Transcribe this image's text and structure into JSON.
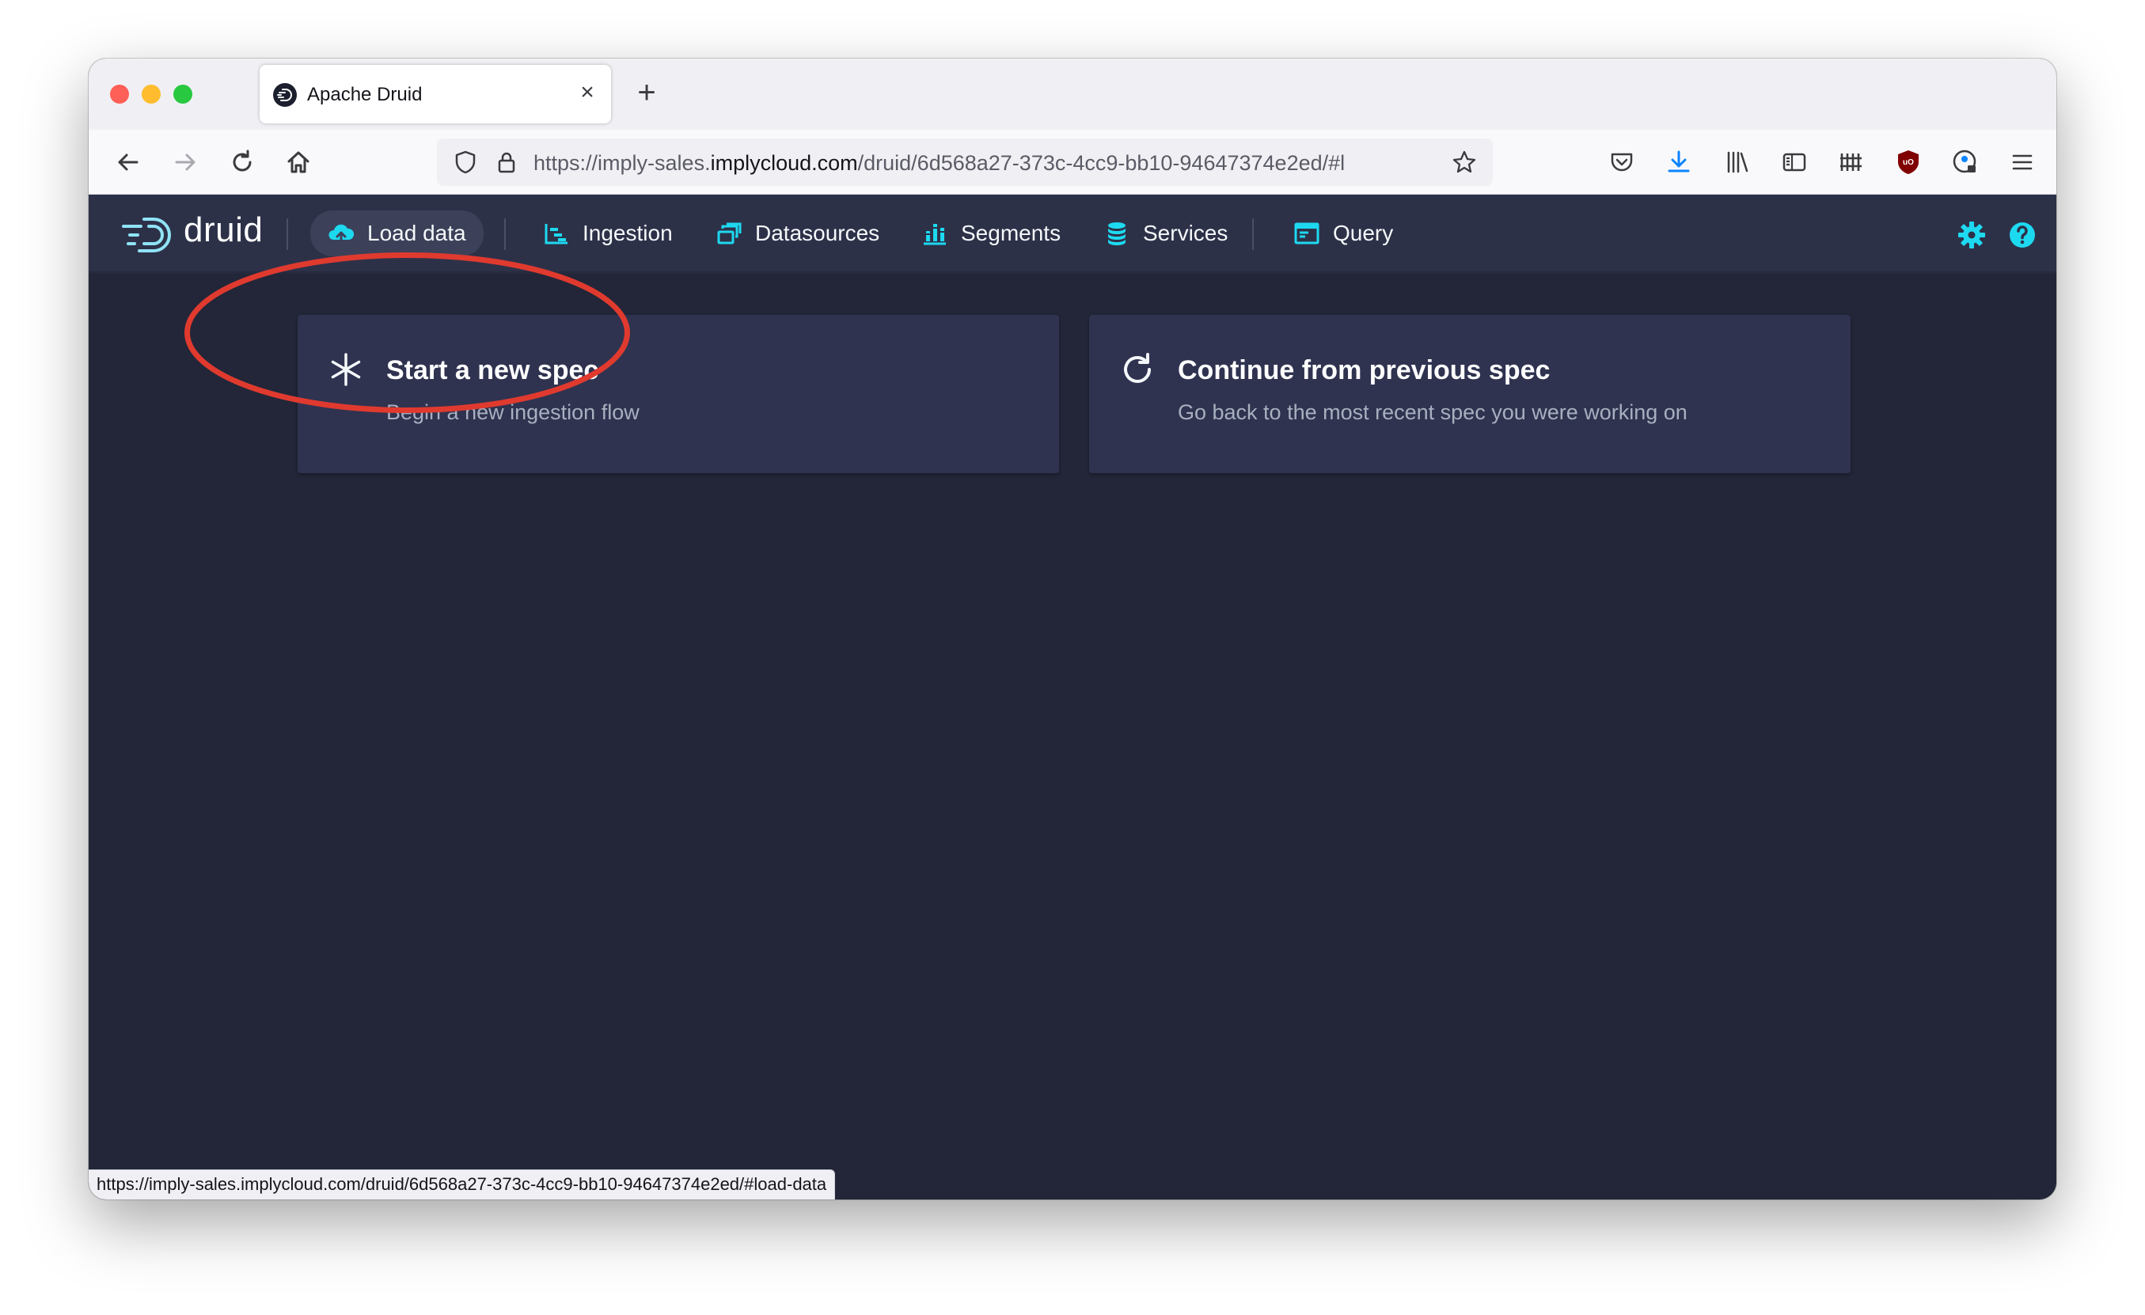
{
  "browser": {
    "tab_title": "Apache Druid",
    "tab_close": "×",
    "new_tab": "+",
    "url_prefix": "https://imply-sales.",
    "url_host": "implycloud.com",
    "url_path": "/druid/6d568a27-373c-4cc9-bb10-94647374e2ed/#l",
    "status_url": "https://imply-sales.implycloud.com/druid/6d568a27-373c-4cc9-bb10-94647374e2ed/#load-data"
  },
  "druid": {
    "logo_text": "druid",
    "nav": [
      {
        "label": "Load data",
        "icon": "cloud-upload-icon",
        "active": true
      },
      {
        "label": "Ingestion",
        "icon": "gantt-chart-icon",
        "active": false
      },
      {
        "label": "Datasources",
        "icon": "multi-select-icon",
        "active": false
      },
      {
        "label": "Segments",
        "icon": "stacked-chart-icon",
        "active": false
      },
      {
        "label": "Services",
        "icon": "database-icon",
        "active": false
      },
      {
        "label": "Query",
        "icon": "application-icon",
        "active": false
      }
    ],
    "accent_color": "#1dd9f0"
  },
  "cards": {
    "new_spec": {
      "title": "Start a new spec",
      "description": "Begin a new ingestion flow",
      "icon": "asterisk-icon"
    },
    "previous_spec": {
      "title": "Continue from previous spec",
      "description": "Go back to the most recent spec you were working on",
      "icon": "refresh-icon"
    }
  },
  "annotation": {
    "color": "#e03a2f"
  }
}
